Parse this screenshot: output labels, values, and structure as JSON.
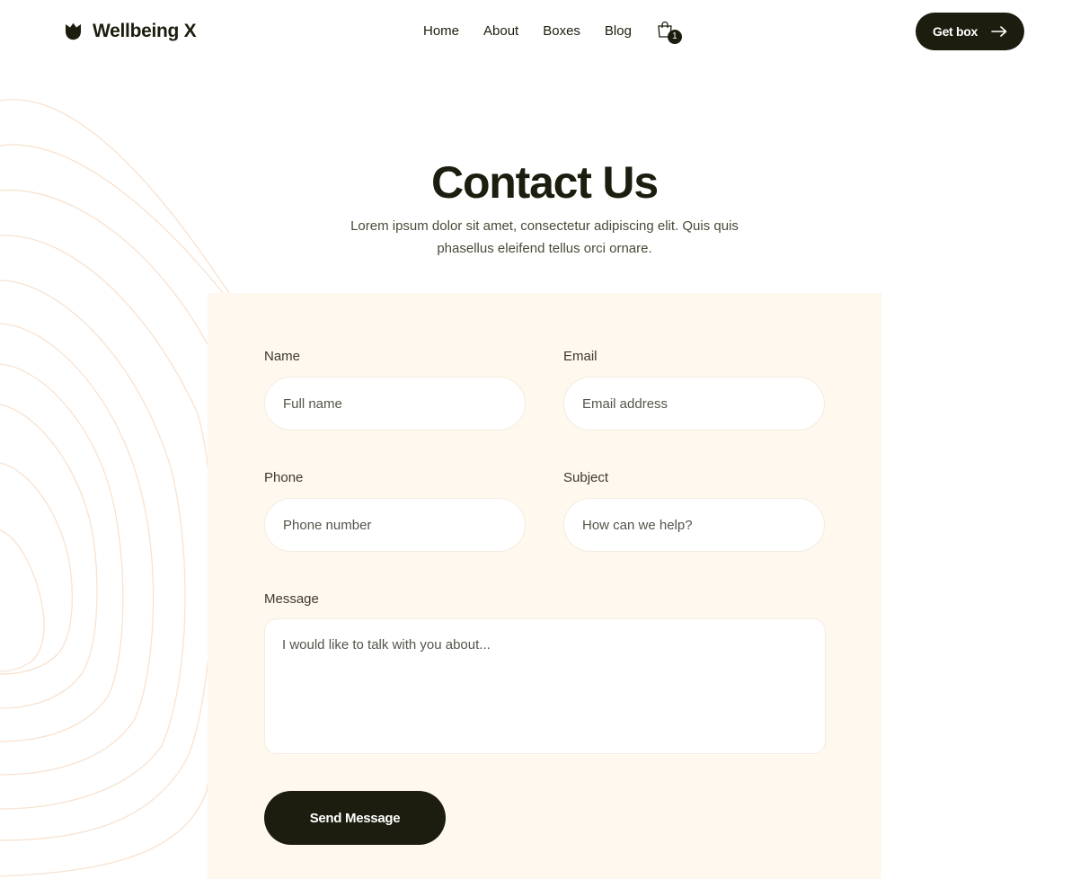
{
  "brand": {
    "name": "Wellbeing X",
    "icon": "tulip-logo-icon"
  },
  "nav": {
    "items": [
      {
        "label": "Home"
      },
      {
        "label": "About"
      },
      {
        "label": "Boxes"
      },
      {
        "label": "Blog"
      }
    ],
    "cart": {
      "icon": "shopping-bag-icon",
      "count": "1"
    },
    "cta": {
      "label": "Get box",
      "icon": "arrow-right-icon"
    }
  },
  "hero": {
    "title": "Contact Us",
    "subtitle": "Lorem ipsum dolor sit amet, consectetur adipiscing elit. Quis quis phasellus eleifend tellus orci ornare."
  },
  "form": {
    "name": {
      "label": "Name",
      "placeholder": "Full name"
    },
    "email": {
      "label": "Email",
      "placeholder": "Email address"
    },
    "phone": {
      "label": "Phone",
      "placeholder": "Phone number"
    },
    "subject": {
      "label": "Subject",
      "placeholder": "How can we help?"
    },
    "message": {
      "label": "Message",
      "placeholder": "I would like to talk with you about..."
    },
    "submit_label": "Send Message"
  },
  "colors": {
    "primary": "#1c1d0e",
    "panel_background": "#fff8ee",
    "decoration": "#f8e2d0"
  }
}
